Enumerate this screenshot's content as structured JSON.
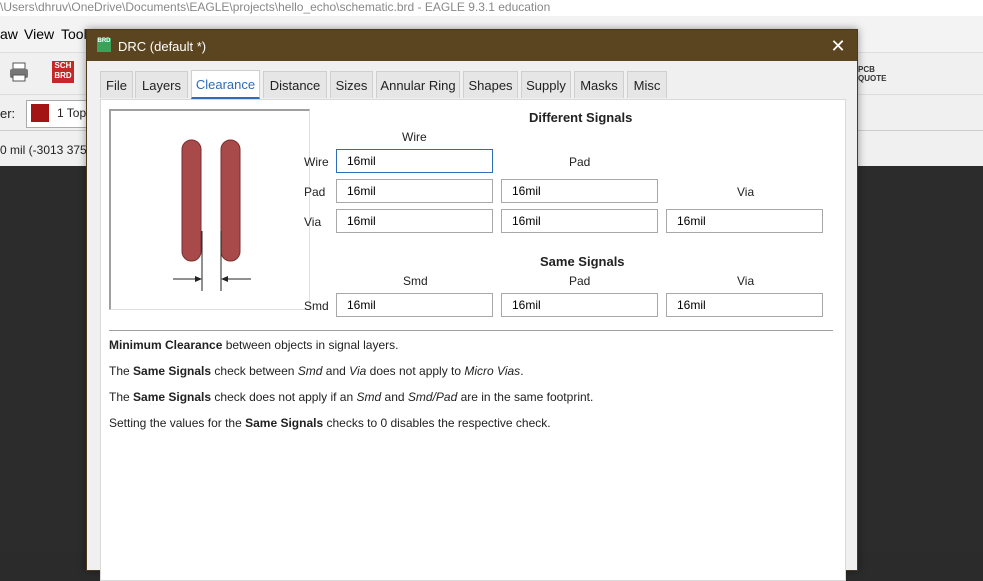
{
  "window": {
    "title": "\\Users\\dhruv\\OneDrive\\Documents\\EAGLE\\projects\\hello_echo\\schematic.brd - EAGLE 9.3.1 education"
  },
  "menu": {
    "items": [
      "aw",
      "View",
      "Tool"
    ]
  },
  "toolbar": {
    "sch_brd_label": "SCH BRD",
    "pcb_quote_label": "PCB QUOTE"
  },
  "layer_bar": {
    "label": "er:",
    "layer_color": "#a31515",
    "layer_name": "1 Top"
  },
  "coord_bar": {
    "text": "0 mil (-3013 375"
  },
  "dialog": {
    "icon_label": "BRD",
    "title": "DRC (default *)",
    "close_label": "✕",
    "tabs": [
      "File",
      "Layers",
      "Clearance",
      "Distance",
      "Sizes",
      "Annular Ring",
      "Shapes",
      "Supply",
      "Masks",
      "Misc"
    ],
    "active_tab": "Clearance",
    "different_signals": {
      "heading": "Different Signals",
      "col_wire": "Wire",
      "col_pad": "Pad",
      "col_via": "Via",
      "row_wire": "Wire",
      "row_pad": "Pad",
      "row_via": "Via",
      "wire_wire": "16mil",
      "pad_wire": "16mil",
      "pad_pad": "16mil",
      "via_wire": "16mil",
      "via_pad": "16mil",
      "via_via": "16mil"
    },
    "same_signals": {
      "heading": "Same Signals",
      "col_smd": "Smd",
      "col_pad": "Pad",
      "col_via": "Via",
      "row_smd": "Smd",
      "smd_smd": "16mil",
      "smd_pad": "16mil",
      "smd_via": "16mil"
    },
    "description": {
      "line1_bold": "Minimum Clearance",
      "line1_rest": " between objects in signal layers.",
      "line2_a": "The ",
      "line2_bold": "Same Signals",
      "line2_b": " check between ",
      "line2_i1": "Smd",
      "line2_c": " and ",
      "line2_i2": "Via",
      "line2_d": " does not apply to ",
      "line2_i3": "Micro Vias",
      "line2_e": ".",
      "line3_a": "The ",
      "line3_bold": "Same Signals",
      "line3_b": " check does not apply if an ",
      "line3_i1": "Smd",
      "line3_c": " and ",
      "line3_i2": "Smd/Pad",
      "line3_d": " are in the same footprint.",
      "line4_a": "Setting the values for the ",
      "line4_bold": "Same Signals",
      "line4_b": " checks to 0 disables the respective check."
    }
  },
  "colors": {
    "title_bar": "#5b4420",
    "active_tab": "#2c6db5",
    "wire_preview": "#a84a4a"
  }
}
